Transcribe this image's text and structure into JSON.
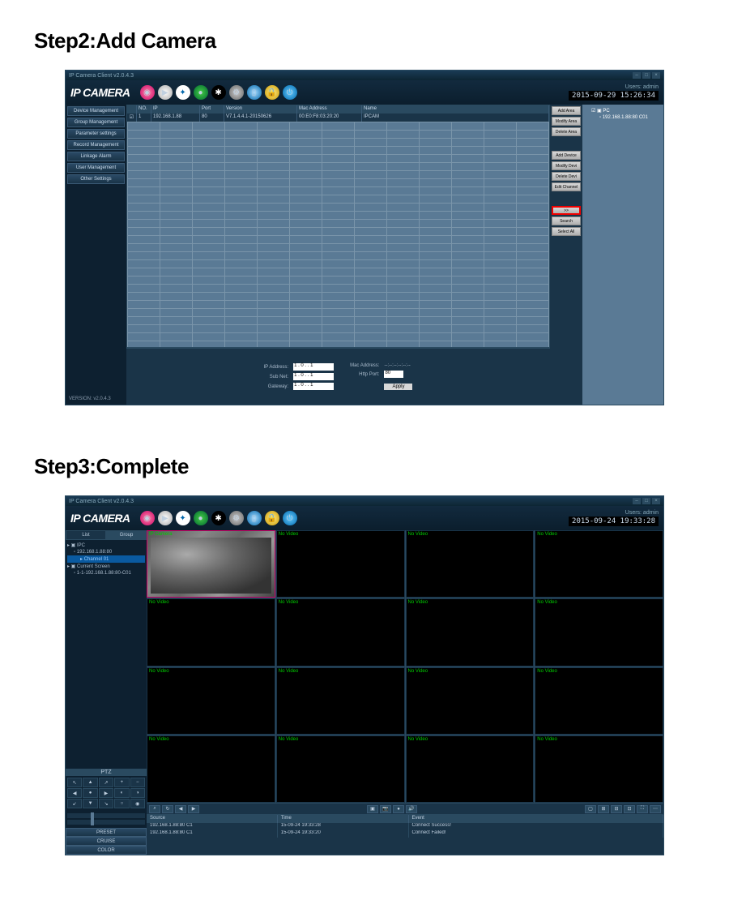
{
  "steps": {
    "s2_title": "Step2:Add Camera",
    "s3_title": "Step3:Complete"
  },
  "common": {
    "titlebar": "IP Camera Client v2.0.4.3",
    "logo": "IP CAMERA",
    "user_label": "Users: admin",
    "icons": [
      "preview",
      "play",
      "target",
      "globe",
      "setting",
      "gear",
      "volume",
      "lock",
      "power"
    ]
  },
  "s2": {
    "timestamp": "2015-09-29 15:26:34",
    "nav": [
      "Device Management",
      "Group Management",
      "Parameter settings",
      "Record Management",
      "Linkage Alarm",
      "User Management",
      "Other Settings"
    ],
    "version": "VERSION: v2.0.4.3",
    "cols": [
      "",
      "NO.",
      "IP",
      "Port",
      "Version",
      "Mac Address",
      "Name"
    ],
    "row": {
      "chk": "☑",
      "no": "1",
      "ip": "192.168.1.88",
      "port": "80",
      "ver": "V7.1.4.4.1-20150626",
      "mac": "00:E0:F8:03:20:20",
      "name": "IPCAM"
    },
    "side_btns_a": [
      "Add Area",
      "Modify Area",
      "Delete Area"
    ],
    "side_btns_b": [
      "Add Device",
      "Modify Devi",
      "Delete Devi",
      "Edit Channel"
    ],
    "side_btns_c": [
      ">>",
      "Search",
      "Select All"
    ],
    "tree": {
      "root": "PC",
      "child": "192.168.1.88:80 C01"
    },
    "form": {
      "ip_label": "IP Address:",
      "ip": "1 . 0 . . 1",
      "subnet_label": "Sub Net:",
      "subnet": "1 . 0 . . 1",
      "gateway_label": "Gateway:",
      "gateway": "1 . 0 . . 1",
      "mac_label": "Mac Address:",
      "mac": "--:--:--:--:--:--",
      "http_label": "Http Port:",
      "http": "80",
      "apply": "Apply"
    }
  },
  "s3": {
    "timestamp": "2015-09-24 19:33:28",
    "tabs": [
      "List",
      "Group"
    ],
    "tree": {
      "root": "IPC",
      "dev": "192.168.1.88:80",
      "ch": "Channel 01",
      "cs": "Current Screen",
      "cs_item": "1-1-192.168.1.88:80-C01"
    },
    "ptz_title": "PTZ",
    "bottom_btns": [
      "PRESET",
      "CRUISE",
      "COLOR"
    ],
    "cell_live": "IP Camera",
    "cell_novideo": "No Video",
    "log_cols": [
      "Source",
      "Time",
      "Event"
    ],
    "log_rows": [
      {
        "src": "192.168.1.88:80 C1",
        "time": "15-09-24 19:33:28",
        "evt": "Connect Success!"
      },
      {
        "src": "192.168.1.88:80 C1",
        "time": "15-09-24 19:33:20",
        "evt": "Connect Failed!"
      }
    ]
  }
}
